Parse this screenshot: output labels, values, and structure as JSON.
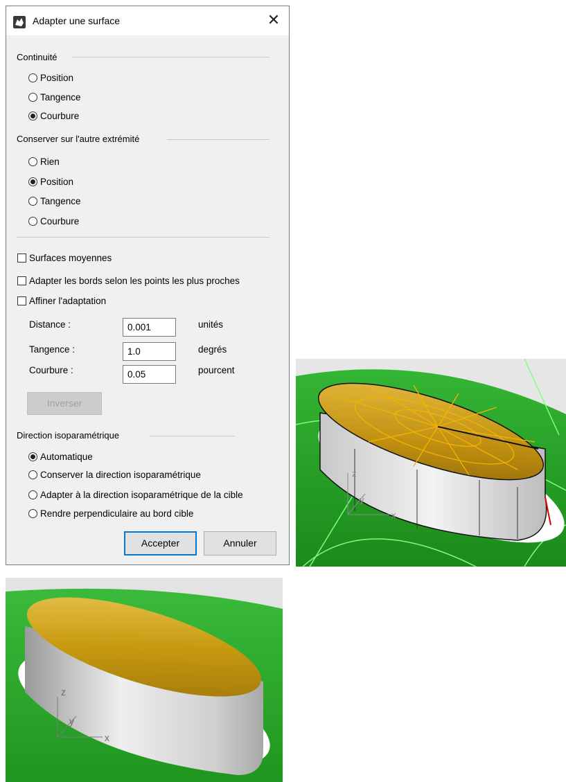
{
  "window": {
    "title": "Adapter une surface",
    "close_glyph": "✕"
  },
  "continuity": {
    "label": "Continuité",
    "options": [
      {
        "label": "Position",
        "selected": false
      },
      {
        "label": "Tangence",
        "selected": false
      },
      {
        "label": "Courbure",
        "selected": true
      }
    ]
  },
  "other_end": {
    "label": "Conserver sur l'autre extrémité",
    "options": [
      {
        "label": "Rien",
        "selected": false
      },
      {
        "label": "Position",
        "selected": true
      },
      {
        "label": "Tangence",
        "selected": false
      },
      {
        "label": "Courbure",
        "selected": false
      }
    ]
  },
  "checkboxes": [
    {
      "label": "Surfaces moyennes",
      "checked": false
    },
    {
      "label": "Adapter les bords selon les points les plus proches",
      "checked": false
    },
    {
      "label": "Affiner l'adaptation",
      "checked": false
    }
  ],
  "fields": [
    {
      "label": "Distance :",
      "value": "0.001",
      "unit": "unités"
    },
    {
      "label": "Tangence :",
      "value": "1.0",
      "unit": "degrés"
    },
    {
      "label": "Courbure :",
      "value": "0.05",
      "unit": "pourcent"
    }
  ],
  "invert_button": "Inverser",
  "isoparm": {
    "label": "Direction isoparamétrique",
    "options": [
      {
        "label": "Automatique",
        "selected": true
      },
      {
        "label": "Conserver la direction isoparamétrique",
        "selected": false
      },
      {
        "label": "Adapter à la direction isoparamétrique de la cible",
        "selected": false
      },
      {
        "label": "Rendre perpendiculaire au bord cible",
        "selected": false
      }
    ]
  },
  "buttons": {
    "accept": "Accepter",
    "cancel": "Annuler"
  },
  "viewport1": {
    "axis_x": "x",
    "axis_y": "y",
    "axis_z": "z"
  },
  "viewport2": {
    "axis_x": "x",
    "axis_y": "y",
    "axis_z": "z"
  },
  "colors": {
    "green": "#1f9e1f",
    "gold": "#c79a0f",
    "isocurve": "#f2b400",
    "accent": "#0078d7"
  }
}
